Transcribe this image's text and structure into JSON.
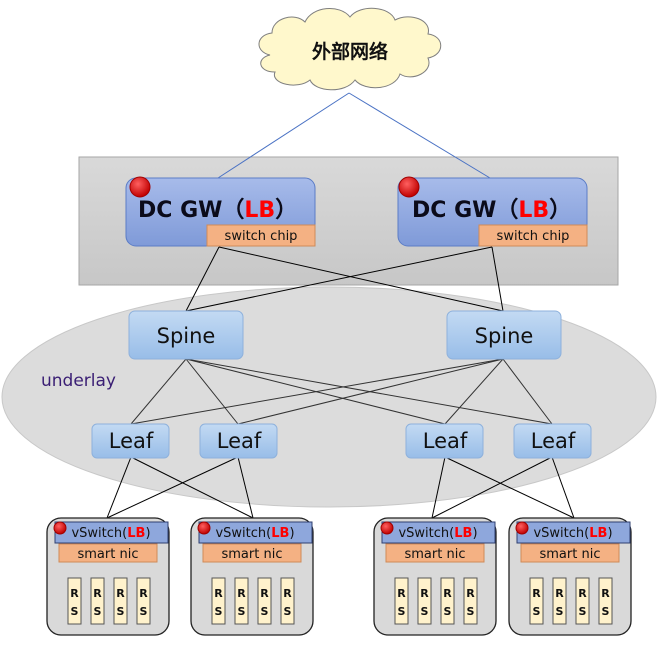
{
  "cloud": {
    "label": "外部网络"
  },
  "dc_gateways": [
    {
      "title": "DC GW",
      "open": "（",
      "lb": "LB",
      "close": "）",
      "chip": "switch chip"
    },
    {
      "title": "DC GW",
      "open": "（",
      "lb": "LB",
      "close": "）",
      "chip": "switch chip"
    }
  ],
  "underlay": {
    "label": "underlay"
  },
  "spines": [
    {
      "label": "Spine"
    },
    {
      "label": "Spine"
    }
  ],
  "leaves": [
    {
      "label": "Leaf"
    },
    {
      "label": "Leaf"
    },
    {
      "label": "Leaf"
    },
    {
      "label": "Leaf"
    }
  ],
  "servers": [
    {
      "vswitch": "vSwitch(",
      "lb": "LB",
      "close": ")",
      "nic": "smart nic",
      "rs": [
        "R",
        "S",
        "R",
        "S",
        "R",
        "S",
        "R",
        "S"
      ]
    },
    {
      "vswitch": "vSwitch(",
      "lb": "LB",
      "close": ")",
      "nic": "smart nic",
      "rs": [
        "R",
        "S",
        "R",
        "S",
        "R",
        "S",
        "R",
        "S"
      ]
    },
    {
      "vswitch": "vSwitch(",
      "lb": "LB",
      "close": ")",
      "nic": "smart nic",
      "rs": [
        "R",
        "S",
        "R",
        "S",
        "R",
        "S",
        "R",
        "S"
      ]
    },
    {
      "vswitch": "vSwitch(",
      "lb": "LB",
      "close": ")",
      "nic": "smart nic",
      "rs": [
        "R",
        "S",
        "R",
        "S",
        "R",
        "S",
        "R",
        "S"
      ]
    }
  ],
  "colors": {
    "gw_fill": "#8ea7dc",
    "chip_fill": "#f4b183",
    "node_fill": "#a9c8ec",
    "red_dot": "#e02020",
    "rs_fill": "#fff2cc",
    "cloud_fill": "#fff8cc"
  }
}
